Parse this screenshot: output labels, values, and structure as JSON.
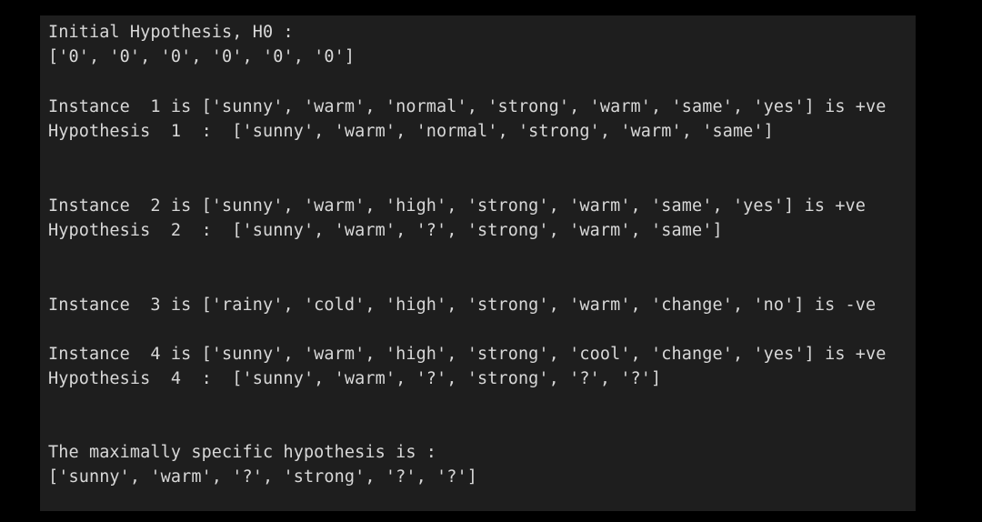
{
  "output": {
    "lines": [
      "Initial Hypothesis, H0 :",
      "['0', '0', '0', '0', '0', '0']",
      "",
      "Instance  1 is ['sunny', 'warm', 'normal', 'strong', 'warm', 'same', 'yes'] is +ve",
      "Hypothesis  1  :  ['sunny', 'warm', 'normal', 'strong', 'warm', 'same']",
      "",
      "",
      "Instance  2 is ['sunny', 'warm', 'high', 'strong', 'warm', 'same', 'yes'] is +ve",
      "Hypothesis  2  :  ['sunny', 'warm', '?', 'strong', 'warm', 'same']",
      "",
      "",
      "Instance  3 is ['rainy', 'cold', 'high', 'strong', 'warm', 'change', 'no'] is -ve",
      "",
      "Instance  4 is ['sunny', 'warm', 'high', 'strong', 'cool', 'change', 'yes'] is +ve",
      "Hypothesis  4  :  ['sunny', 'warm', '?', 'strong', '?', '?']",
      "",
      "",
      "The maximally specific hypothesis is :",
      "['sunny', 'warm', '?', 'strong', '?', '?']"
    ]
  }
}
